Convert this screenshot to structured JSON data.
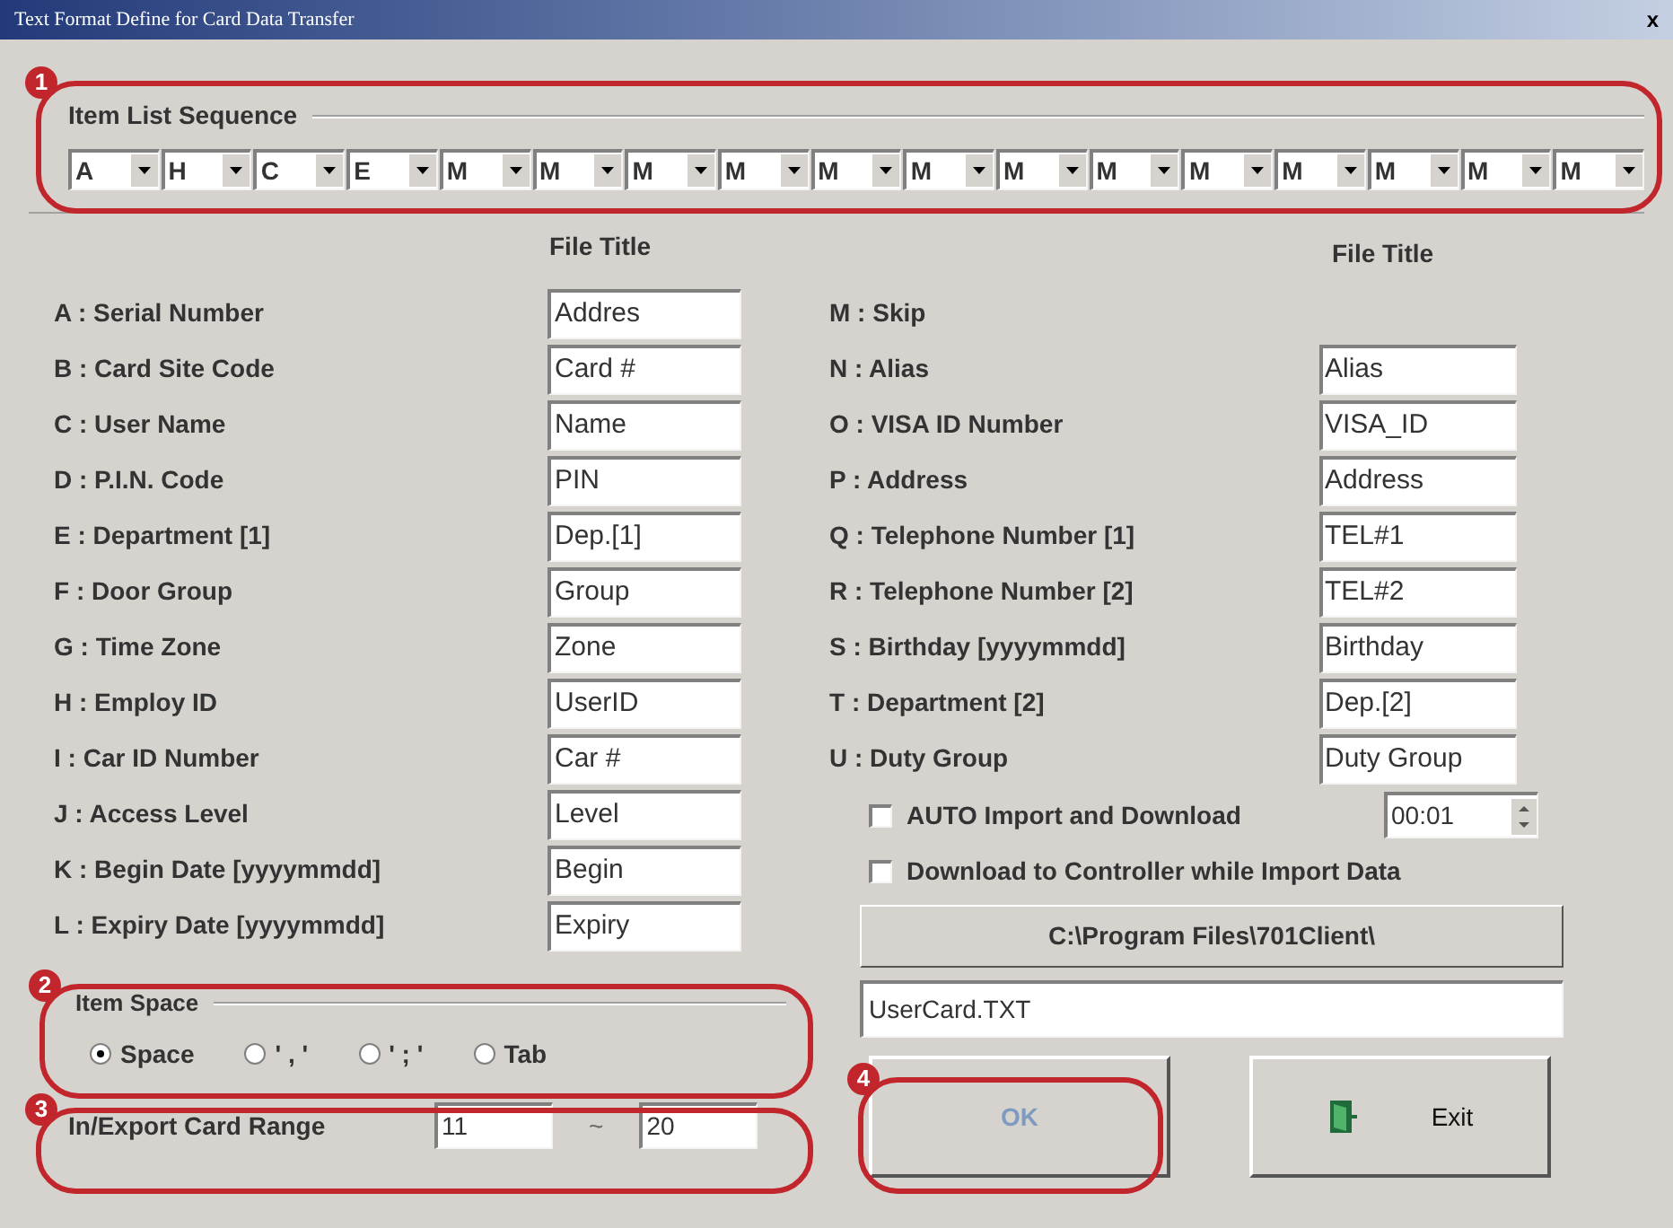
{
  "window": {
    "title": "Text Format Define for Card Data Transfer",
    "close": "x"
  },
  "item_list_sequence": {
    "title": "Item List Sequence",
    "items": [
      "A",
      "H",
      "C",
      "E",
      "M",
      "M",
      "M",
      "M",
      "M",
      "M",
      "M",
      "M",
      "M",
      "M",
      "M",
      "M",
      "M"
    ]
  },
  "left_fields": {
    "header": "File Title",
    "items": [
      {
        "label": "A : Serial Number",
        "value": "Addres"
      },
      {
        "label": "B : Card Site Code",
        "value": "Card #"
      },
      {
        "label": "C : User Name",
        "value": "Name"
      },
      {
        "label": "D : P.I.N. Code",
        "value": "PIN"
      },
      {
        "label": "E : Department [1]",
        "value": "Dep.[1]"
      },
      {
        "label": "F : Door Group",
        "value": "Group"
      },
      {
        "label": "G : Time Zone",
        "value": "Zone"
      },
      {
        "label": "H : Employ ID",
        "value": "UserID"
      },
      {
        "label": "I : Car ID Number",
        "value": "Car #"
      },
      {
        "label": "J : Access Level",
        "value": "Level"
      },
      {
        "label": "K : Begin Date [yyyymmdd]",
        "value": "Begin"
      },
      {
        "label": "L : Expiry Date [yyyymmdd]",
        "value": "Expiry"
      }
    ]
  },
  "right_fields": {
    "header": "File Title",
    "items": [
      {
        "kind": "label",
        "label": "M : Skip"
      },
      {
        "kind": "field",
        "label": "N : Alias",
        "value": "Alias"
      },
      {
        "kind": "field",
        "label": "O : VISA ID Number",
        "value": "VISA_ID"
      },
      {
        "kind": "field",
        "label": "P : Address",
        "value": "Address"
      },
      {
        "kind": "field",
        "label": "Q : Telephone Number [1]",
        "value": "TEL#1"
      },
      {
        "kind": "field",
        "label": "R : Telephone Number [2]",
        "value": "TEL#2"
      },
      {
        "kind": "field",
        "label": "S : Birthday  [yyyymmdd]",
        "value": "Birthday"
      },
      {
        "kind": "field",
        "label": "T : Department [2]",
        "value": "Dep.[2]"
      },
      {
        "kind": "field",
        "label": "U : Duty Group",
        "value": "Duty Group"
      }
    ]
  },
  "auto_import": {
    "label": "AUTO Import and Download",
    "checked": false,
    "interval": "00:01"
  },
  "download_to_controller": {
    "label": "Download to Controller while Import Data",
    "checked": false
  },
  "path_button": "C:\\Program Files\\701Client\\",
  "file_name": "UserCard.TXT",
  "item_space": {
    "title": "Item Space",
    "options": [
      {
        "label": "Space",
        "selected": true
      },
      {
        "label": "' , '",
        "selected": false
      },
      {
        "label": "' ; '",
        "selected": false
      },
      {
        "label": "Tab",
        "selected": false
      }
    ]
  },
  "card_range": {
    "label": "In/Export Card Range",
    "from": "11",
    "separator": "~",
    "to": "20"
  },
  "buttons": [
    {
      "kind": "ok",
      "label": "OK",
      "disabled": true
    },
    {
      "kind": "exit",
      "label": "Exit",
      "disabled": false
    }
  ],
  "callouts": [
    {
      "number": "1"
    },
    {
      "number": "2"
    },
    {
      "number": "3"
    },
    {
      "number": "4"
    }
  ]
}
